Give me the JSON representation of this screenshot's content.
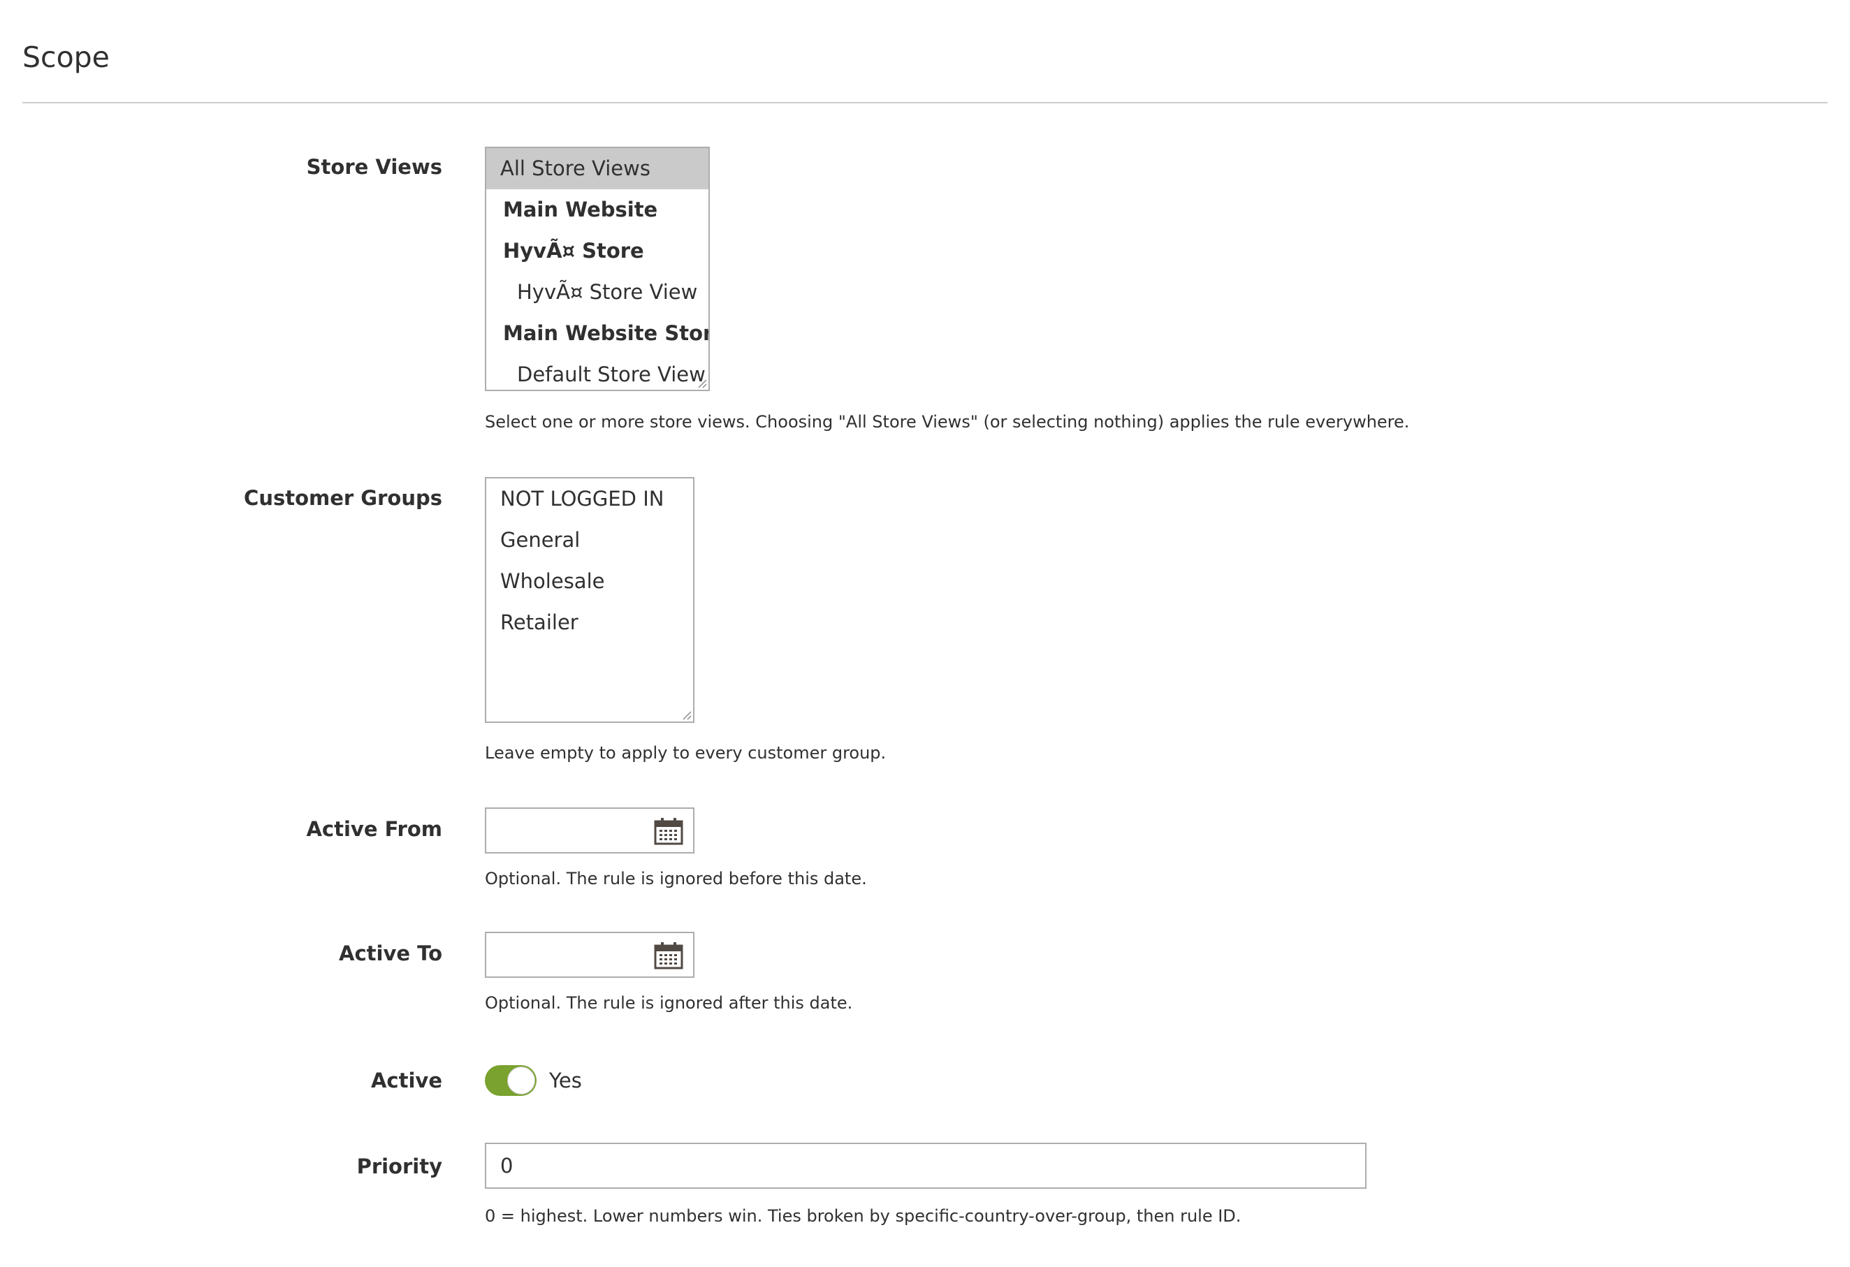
{
  "section": {
    "title": "Scope"
  },
  "store_views": {
    "label": "Store Views",
    "items": [
      {
        "text": "All Store Views",
        "kind": "option",
        "selected": true
      },
      {
        "text": "Main Website",
        "kind": "group"
      },
      {
        "text": "HyvÃ¤ Store",
        "kind": "group"
      },
      {
        "text": "HyvÃ¤ Store View",
        "kind": "sub"
      },
      {
        "text": "Main Website Store",
        "kind": "group"
      },
      {
        "text": "Default Store View",
        "kind": "sub"
      }
    ],
    "note": "Select one or more store views. Choosing \"All Store Views\" (or selecting nothing) applies the rule everywhere."
  },
  "customer_groups": {
    "label": "Customer Groups",
    "items": [
      "NOT LOGGED IN",
      "General",
      "Wholesale",
      "Retailer"
    ],
    "note": "Leave empty to apply to every customer group."
  },
  "active_from": {
    "label": "Active From",
    "value": "",
    "note": "Optional. The rule is ignored before this date.",
    "icon": "calendar-icon"
  },
  "active_to": {
    "label": "Active To",
    "value": "",
    "note": "Optional. The rule is ignored after this date.",
    "icon": "calendar-icon"
  },
  "active": {
    "label": "Active",
    "state": true,
    "state_text": "Yes",
    "on_color": "#79a22e"
  },
  "priority": {
    "label": "Priority",
    "value": "0",
    "note": "0 = highest. Lower numbers win. Ties broken by specific-country-over-group, then rule ID."
  }
}
